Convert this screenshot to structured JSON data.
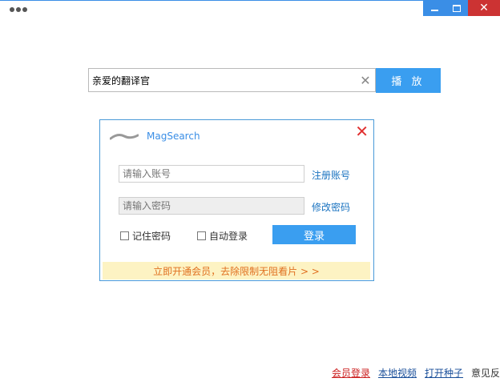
{
  "search": {
    "value": "亲爱的翻译官",
    "play_label": "播 放"
  },
  "dialog": {
    "title": "MagSearch",
    "account_placeholder": "请输入账号",
    "password_placeholder": "请输入密码",
    "register_link": "注册账号",
    "change_password_link": "修改密码",
    "remember_label": "记住密码",
    "auto_login_label": "自动登录",
    "login_label": "登录",
    "vip_banner": "立即开通会员，去除限制无阻看片 > >"
  },
  "footer": {
    "vip_login": "会员登录",
    "local_video": "本地视频",
    "open_torrent": "打开种子",
    "feedback": "意见反馈"
  },
  "colors": {
    "accent": "#3a9ef0",
    "close": "#cc3333",
    "vip_text": "#e07020",
    "banner_bg": "#fdf3c3"
  }
}
